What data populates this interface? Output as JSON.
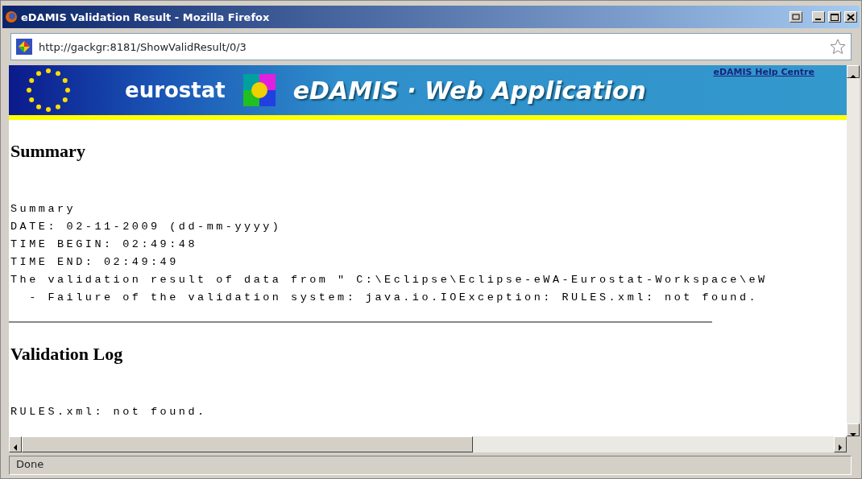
{
  "window": {
    "title": "eDAMIS Validation Result - Mozilla Firefox"
  },
  "address_bar": {
    "url": "http://gackgr:8181/ShowValidResult/0/3"
  },
  "banner": {
    "brand": "eurostat",
    "app_title": "eDAMIS · Web Application",
    "help_link": "eDAMIS Help Centre"
  },
  "sections": [
    {
      "heading": "Summary",
      "lines": [
        "Summary",
        "DATE: 02-11-2009 (dd-mm-yyyy)",
        "TIME BEGIN: 02:49:48",
        "TIME END: 02:49:49",
        "The validation result of data from \" C:\\Eclipse\\Eclipse-eWA-Eurostat-Workspace\\eW",
        "  - Failure of the validation system: java.io.IOException: RULES.xml: not found."
      ],
      "rule_after": true
    },
    {
      "heading": "Validation Log",
      "lines": [
        "RULES.xml: not found."
      ],
      "rule_after": false
    }
  ],
  "status_bar": {
    "text": "Done"
  }
}
